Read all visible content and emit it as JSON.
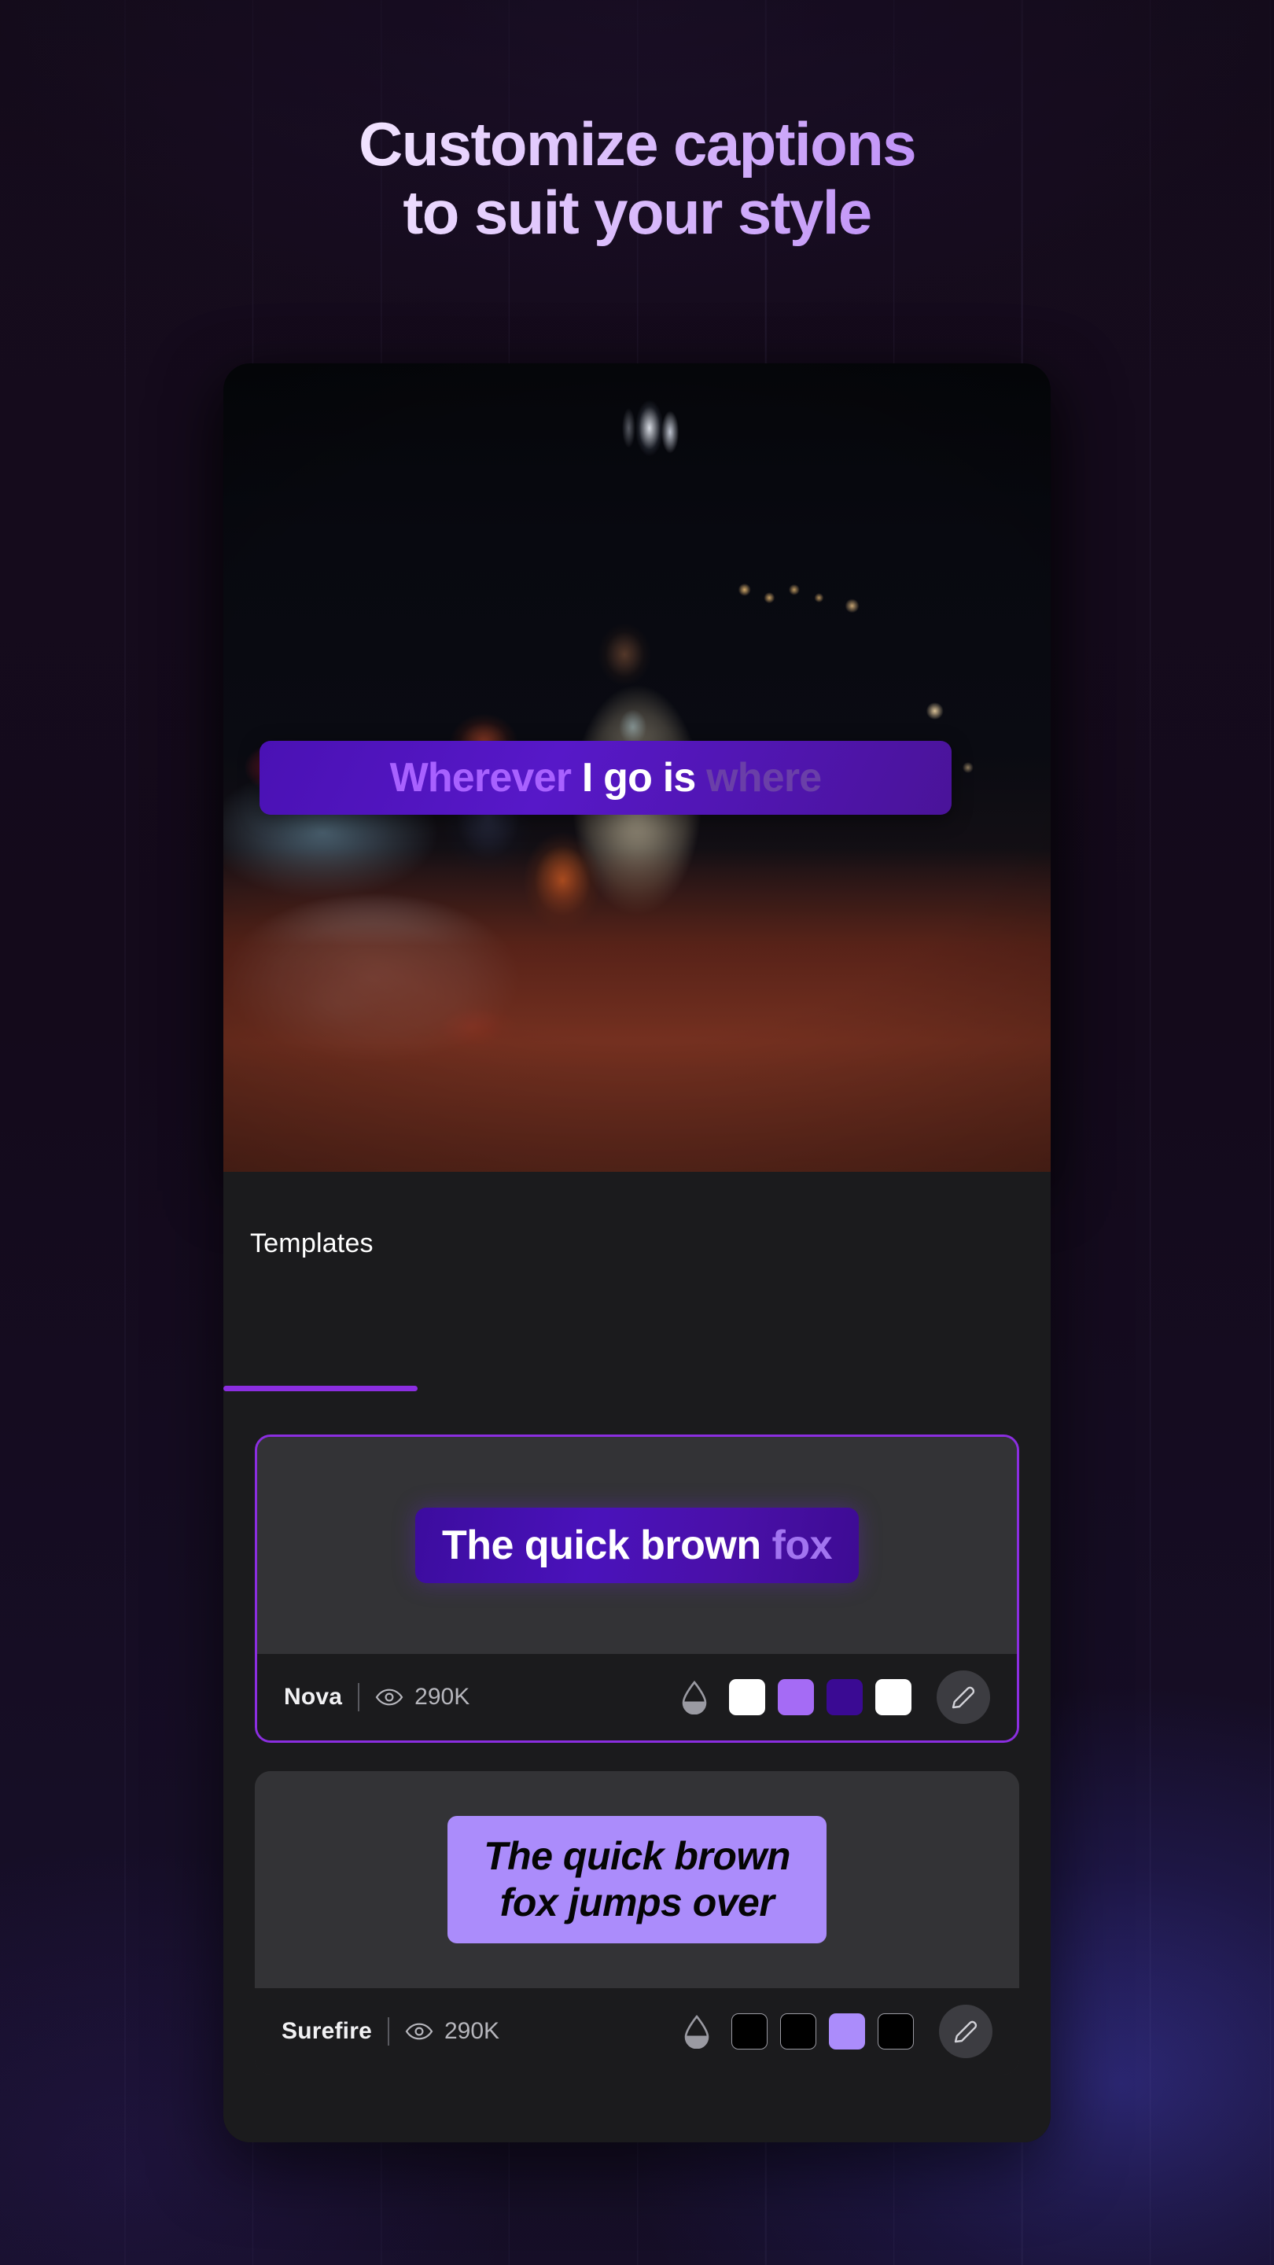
{
  "headline": {
    "line1": "Customize captions",
    "line2": "to suit your style"
  },
  "preview": {
    "caption": {
      "word_active": "Wherever",
      "word_current": "I go is",
      "word_upcoming": "where"
    },
    "image_alt": "night-street-scene-man-and-woman-by-car"
  },
  "tabs": [
    {
      "label": "Templates",
      "selected": true
    }
  ],
  "templates": [
    {
      "name": "Nova",
      "views": "290K",
      "selected": true,
      "preview_text_a": "The quick brown ",
      "preview_text_b": "fox",
      "opacity_icon": "droplet-icon",
      "swatches": [
        "#ffffff",
        "#a56bf5",
        "#3a0a93",
        "#ffffff"
      ],
      "swatch_bordered": [
        false,
        false,
        false,
        false
      ],
      "edit_icon": "pencil-icon",
      "eye_icon": "eye-icon"
    },
    {
      "name": "Surefire",
      "views": "290K",
      "selected": false,
      "preview_line1": "The quick brown",
      "preview_line2": "fox jumps over",
      "opacity_icon": "droplet-icon",
      "swatches": [
        "#000000",
        "#000000",
        "#ab8cfb",
        "#000000"
      ],
      "swatch_bordered": [
        true,
        true,
        false,
        true
      ],
      "edit_icon": "pencil-icon",
      "eye_icon": "eye-icon"
    }
  ],
  "colors": {
    "accent": "#8b2ee0",
    "accent_light": "#a861ff",
    "page_bg": "#140a1b",
    "panel_bg": "#1b1b1d",
    "card_bg": "#2b2b2e"
  }
}
